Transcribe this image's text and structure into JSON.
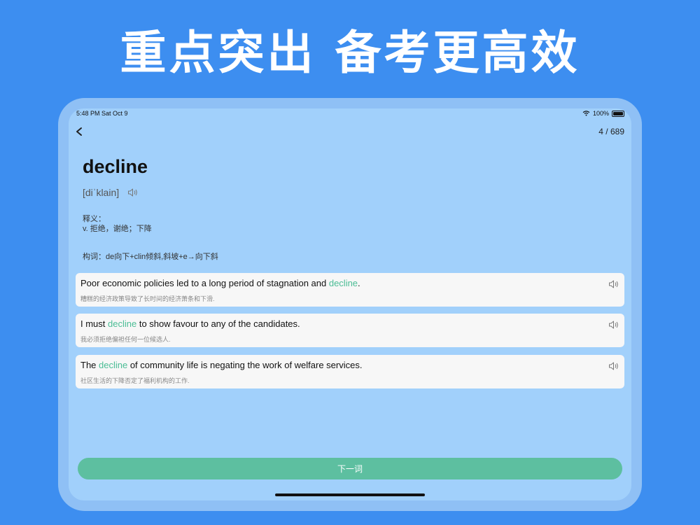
{
  "headline": "重点突出 备考更高效",
  "status_bar": {
    "time_date": "5:48 PM   Sat Oct 9",
    "battery": "100%"
  },
  "header": {
    "counter": "4 / 689"
  },
  "word": {
    "term": "decline",
    "phonetic": "[diˈklain]",
    "definition_label": "释义：",
    "definition": "v. 拒绝，谢绝；下降",
    "etymology": "构词：de向下+clin倾斜,斜坡+e→向下斜"
  },
  "examples": [
    {
      "before": "Poor economic policies led to a long period of stagnation and ",
      "highlight": "decline",
      "after": ".",
      "translation": "糟糕的经济政策导致了长时间的经济萧条和下滑."
    },
    {
      "before": "I must ",
      "highlight": "decline",
      "after": " to show favour to any of the candidates.",
      "translation": "我必须拒绝偏袒任何一位候选人."
    },
    {
      "before": "The ",
      "highlight": "decline",
      "after": " of community life is negating the work of welfare services.",
      "translation": "社区生活的下降否定了福利机构的工作."
    }
  ],
  "next_button": "下一词",
  "icons": [
    "back-chevron-icon",
    "speaker-icon",
    "wifi-icon",
    "battery-icon"
  ],
  "colors": {
    "background": "#3d8ef0",
    "screen": "#a1d0fb",
    "accent": "#5dbfa0",
    "highlight": "#4bbd95"
  }
}
